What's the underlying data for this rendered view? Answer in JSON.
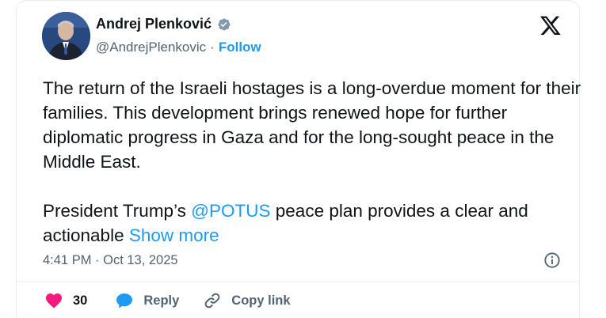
{
  "author": {
    "name": "Andrej Plenković",
    "handle": "@AndrejPlenkovic",
    "separator": "·",
    "follow_label": "Follow"
  },
  "tweet": {
    "paragraph1": "The return of the Israeli hostages is a long-overdue moment for their families. This development brings renewed hope for further diplomatic progress in Gaza and for the long-sought peace in the Middle East.",
    "paragraph2_before": "President Trump’s ",
    "paragraph2_mention": "@POTUS",
    "paragraph2_after": " peace plan provides a clear and actionable ",
    "show_more": "Show more"
  },
  "timestamp": "4:41 PM · Oct 13, 2025",
  "actions": {
    "like_count": "30",
    "reply_label": "Reply",
    "copy_link_label": "Copy link"
  },
  "colors": {
    "accent": "#1d9bf0",
    "like": "#f91880",
    "secondary_text": "#536471",
    "primary_text": "#0f1419"
  },
  "icons": {
    "verified": "verified-badge-icon",
    "x_logo": "x-logo-icon",
    "info": "info-icon",
    "like": "heart-icon",
    "reply": "speech-bubble-icon",
    "copy_link": "link-icon"
  }
}
